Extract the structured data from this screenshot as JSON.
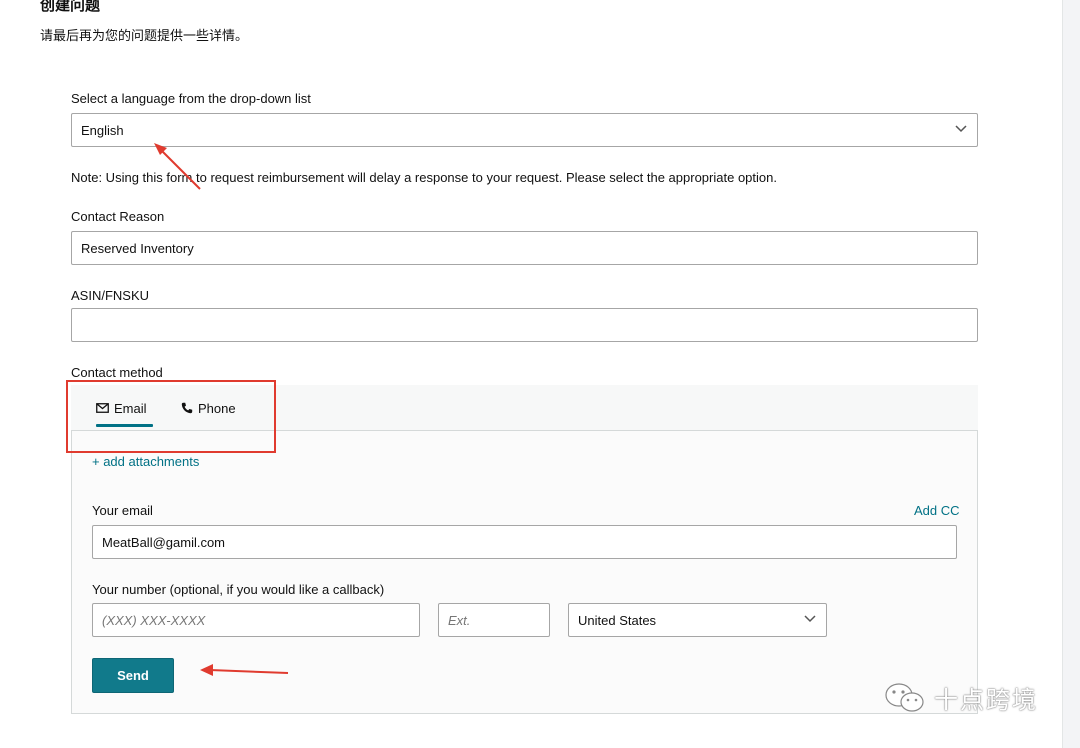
{
  "header": {
    "title": "创建问题",
    "subtitle": "请最后再为您的问题提供一些详情。"
  },
  "language": {
    "label": "Select a language from the drop-down list",
    "value": "English"
  },
  "note": "Note: Using this form to request reimbursement will delay a response to your request. Please select the appropriate option.",
  "contact_reason": {
    "label": "Contact Reason",
    "value": "Reserved Inventory"
  },
  "asin": {
    "label": "ASIN/FNSKU",
    "value": ""
  },
  "contact_method": {
    "label": "Contact method",
    "tabs": [
      {
        "label": "Email",
        "icon": "mail-icon",
        "selected": true
      },
      {
        "label": "Phone",
        "icon": "phone-icon",
        "selected": false
      }
    ]
  },
  "email_panel": {
    "add_attachments": "+ add attachments",
    "email_label": "Your email",
    "add_cc": "Add CC",
    "email_value": "MeatBall@gamil.com",
    "number_label": "Your number (optional, if you would like a callback)",
    "number_placeholder": "(XXX) XXX-XXXX",
    "ext_placeholder": "Ext.",
    "country_value": "United States",
    "send_label": "Send"
  },
  "watermark": {
    "text": "十点跨境"
  },
  "colors": {
    "accent": "#007185",
    "button": "#117a8b",
    "annotation": "#e03b2f"
  }
}
